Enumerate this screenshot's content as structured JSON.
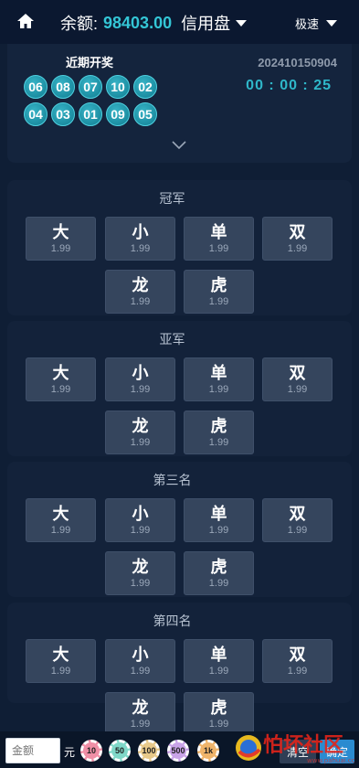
{
  "header": {
    "balance_label": "余额:",
    "balance_value": "98403.00",
    "mode_label": "信用盘",
    "speed_label": "极速"
  },
  "draw": {
    "title": "近期开奖",
    "numbers": [
      "06",
      "08",
      "07",
      "10",
      "02",
      "04",
      "03",
      "01",
      "09",
      "05"
    ],
    "issue": "202410150904",
    "countdown": "00 : 00 : 25"
  },
  "sections": [
    {
      "title": "冠军",
      "options": [
        {
          "label": "大",
          "odds": "1.99"
        },
        {
          "label": "小",
          "odds": "1.99"
        },
        {
          "label": "单",
          "odds": "1.99"
        },
        {
          "label": "双",
          "odds": "1.99"
        },
        {
          "label": "龙",
          "odds": "1.99"
        },
        {
          "label": "虎",
          "odds": "1.99"
        }
      ]
    },
    {
      "title": "亚军",
      "options": [
        {
          "label": "大",
          "odds": "1.99"
        },
        {
          "label": "小",
          "odds": "1.99"
        },
        {
          "label": "单",
          "odds": "1.99"
        },
        {
          "label": "双",
          "odds": "1.99"
        },
        {
          "label": "龙",
          "odds": "1.99"
        },
        {
          "label": "虎",
          "odds": "1.99"
        }
      ]
    },
    {
      "title": "第三名",
      "options": [
        {
          "label": "大",
          "odds": "1.99"
        },
        {
          "label": "小",
          "odds": "1.99"
        },
        {
          "label": "单",
          "odds": "1.99"
        },
        {
          "label": "双",
          "odds": "1.99"
        },
        {
          "label": "龙",
          "odds": "1.99"
        },
        {
          "label": "虎",
          "odds": "1.99"
        }
      ]
    },
    {
      "title": "第四名",
      "options": [
        {
          "label": "大",
          "odds": "1.99"
        },
        {
          "label": "小",
          "odds": "1.99"
        },
        {
          "label": "单",
          "odds": "1.99"
        },
        {
          "label": "双",
          "odds": "1.99"
        },
        {
          "label": "龙",
          "odds": "1.99"
        },
        {
          "label": "虎",
          "odds": "1.99"
        }
      ]
    }
  ],
  "bottom": {
    "amount_placeholder": "金额",
    "unit": "元",
    "chips": [
      {
        "label": "10",
        "color": "#f08fa6"
      },
      {
        "label": "50",
        "color": "#7fd8c8"
      },
      {
        "label": "100",
        "color": "#e8c98a"
      },
      {
        "label": "500",
        "color": "#c9a3e8"
      },
      {
        "label": "1k",
        "color": "#f0b46a"
      }
    ],
    "clear_label": "清空",
    "confirm_label": "确定"
  },
  "watermark_text": "怕坏社区"
}
